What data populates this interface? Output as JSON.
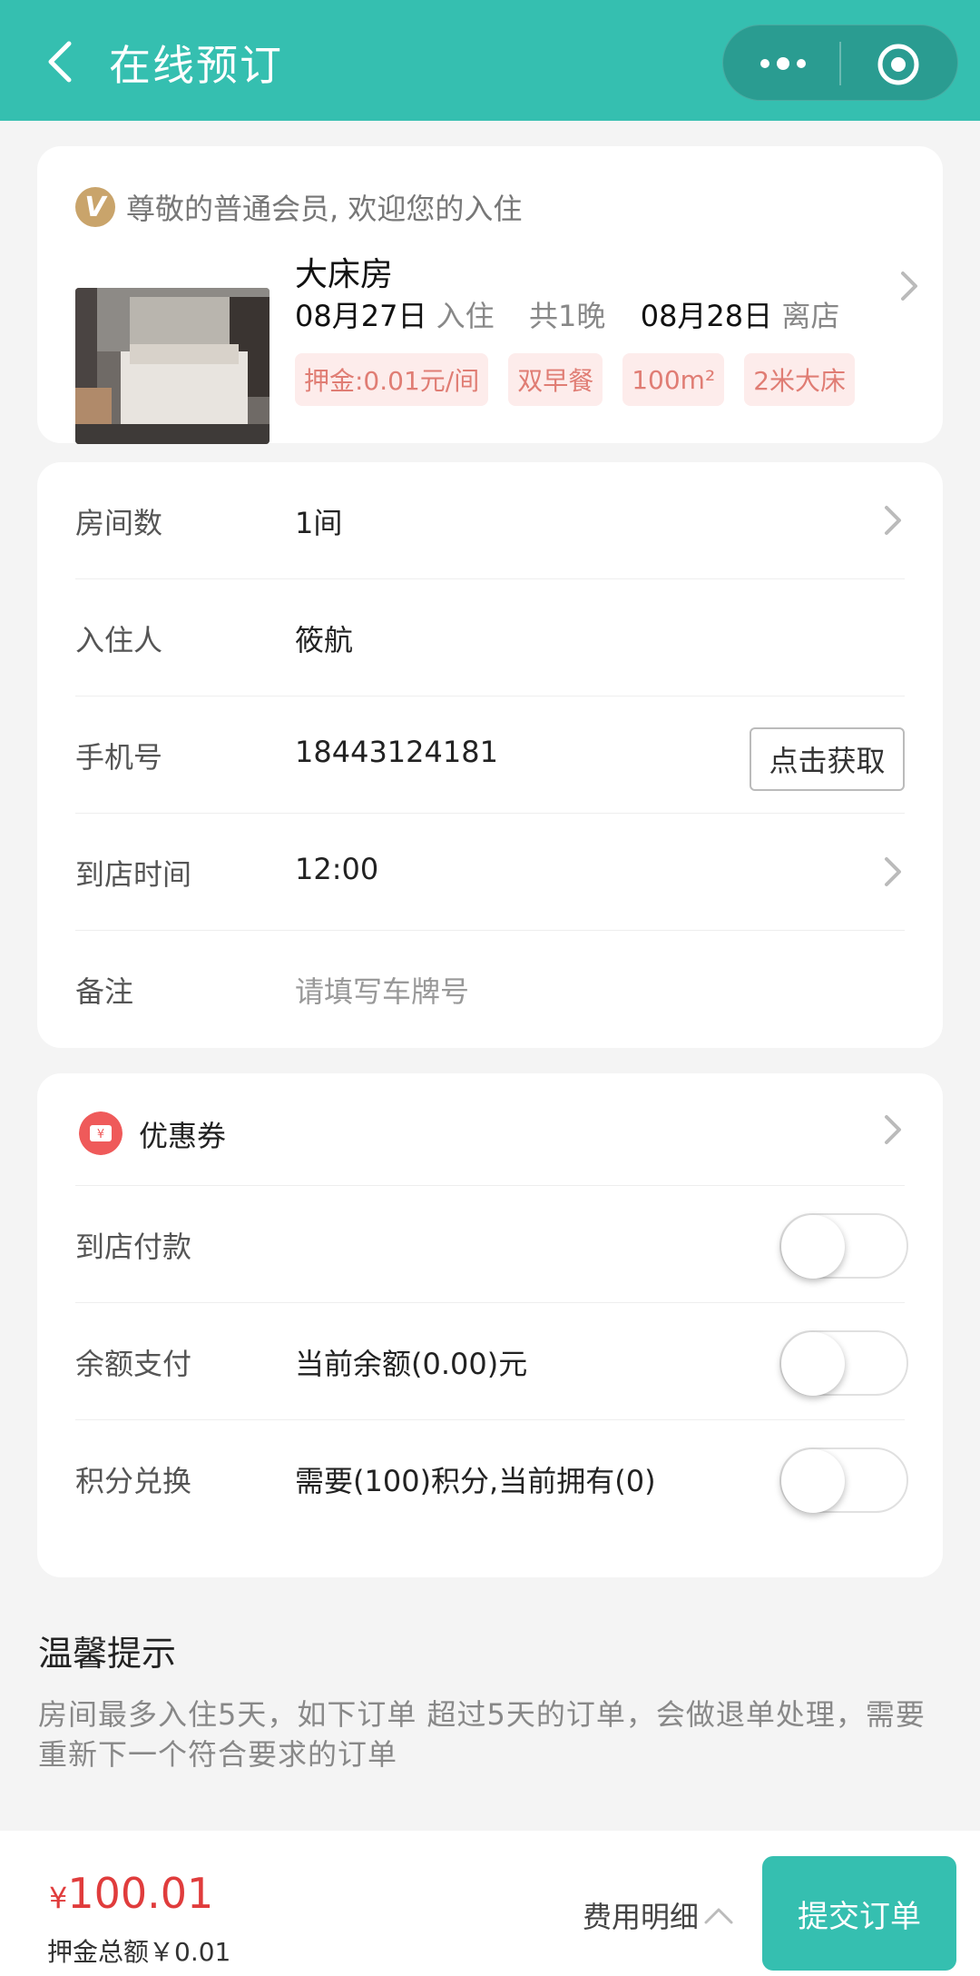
{
  "header": {
    "title": "在线预订",
    "menu_icon": "more-dots-icon",
    "close_icon": "target-icon",
    "accent": "#35bfb0"
  },
  "booking": {
    "member_badge": "V",
    "member_text": "尊敬的普通会员, 欢迎您的入住",
    "room_name": "大床房",
    "checkin_date": "08月27日",
    "checkin_label": "入住",
    "nights": "共1晚",
    "checkout_date": "08月28日",
    "checkout_label": "离店",
    "tags": [
      "押金:0.01元/间",
      "双早餐",
      "100m²",
      "2米大床"
    ]
  },
  "form": {
    "rooms": {
      "label": "房间数",
      "value": "1间"
    },
    "guest": {
      "label": "入住人",
      "value": "筱航"
    },
    "phone": {
      "label": "手机号",
      "value": "18443124181",
      "button": "点击获取"
    },
    "arrival": {
      "label": "到店时间",
      "value": "12:00"
    },
    "remark": {
      "label": "备注",
      "placeholder": "请填写车牌号"
    }
  },
  "payment": {
    "coupon": {
      "label": "优惠券"
    },
    "pay_at_hotel": {
      "label": "到店付款",
      "enabled": false
    },
    "balance": {
      "label": "余额支付",
      "value": "当前余额(0.00)元",
      "enabled": false
    },
    "points": {
      "label": "积分兑换",
      "value": "需要(100)积分,当前拥有(0)",
      "enabled": false
    }
  },
  "tips": {
    "title": "温馨提示",
    "body": "房间最多入住5天，如下订单 超过5天的订单，会做退单处理，需要重新下一个符合要求的订单"
  },
  "footer": {
    "currency": "¥",
    "total": "100.01",
    "deposit": "押金总额￥0.01",
    "detail": "费用明细",
    "submit": "提交订单"
  }
}
